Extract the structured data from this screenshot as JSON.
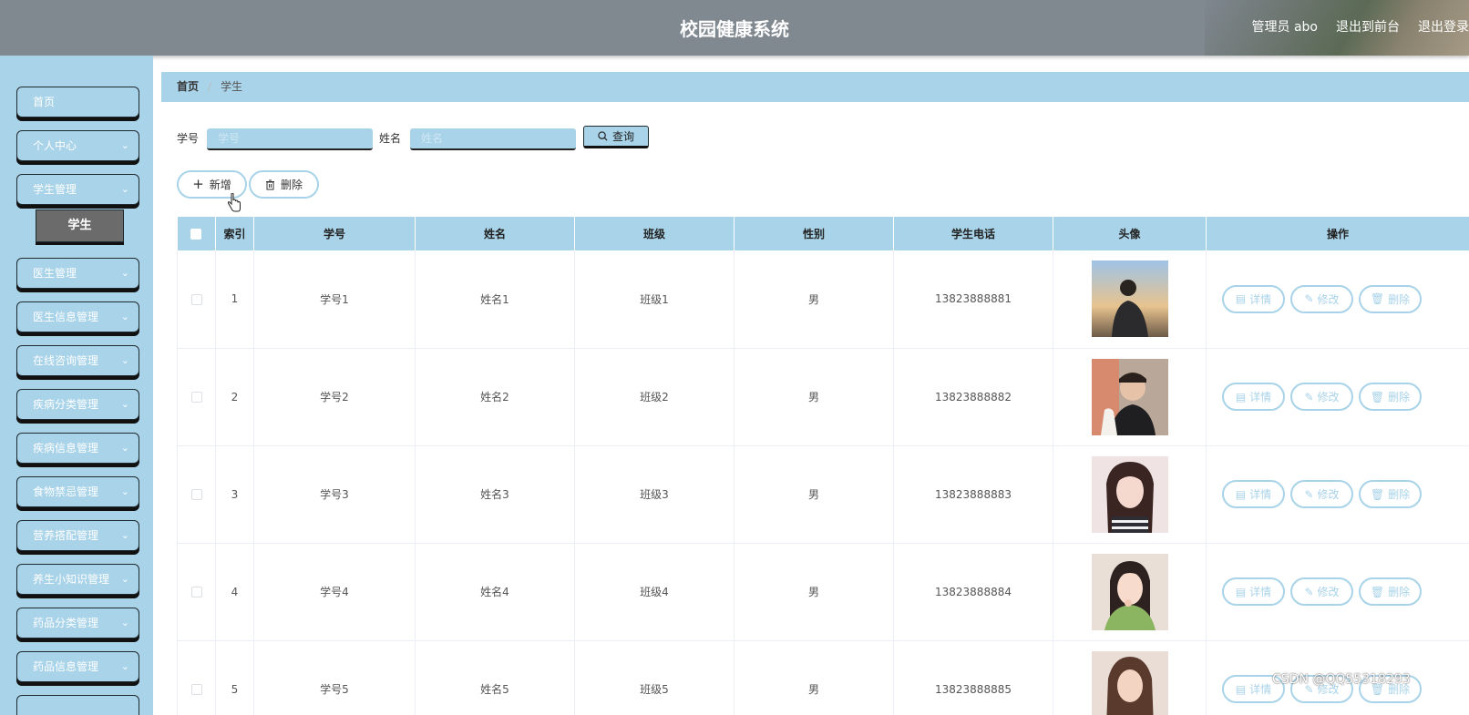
{
  "header": {
    "title": "校园健康系统",
    "admin": "管理员 abo",
    "exit_front": "退出到前台",
    "logout": "退出登录"
  },
  "sidebar": {
    "items": [
      {
        "label": "首页",
        "expandable": false
      },
      {
        "label": "个人中心",
        "expandable": true
      },
      {
        "label": "学生管理",
        "expandable": true
      },
      {
        "label": "医生管理",
        "expandable": true
      },
      {
        "label": "医生信息管理",
        "expandable": true
      },
      {
        "label": "在线咨询管理",
        "expandable": true
      },
      {
        "label": "疾病分类管理",
        "expandable": true
      },
      {
        "label": "疾病信息管理",
        "expandable": true
      },
      {
        "label": "食物禁忌管理",
        "expandable": true
      },
      {
        "label": "营养搭配管理",
        "expandable": true
      },
      {
        "label": "养生小知识管理",
        "expandable": true
      },
      {
        "label": "药品分类管理",
        "expandable": true
      },
      {
        "label": "药品信息管理",
        "expandable": true
      }
    ],
    "sub_item": "学生"
  },
  "breadcrumb": {
    "home": "首页",
    "current": "学生"
  },
  "search": {
    "student_no_label": "学号",
    "student_no_placeholder": "学号",
    "name_label": "姓名",
    "name_placeholder": "姓名",
    "button": "查询"
  },
  "actions": {
    "add": "新增",
    "delete": "删除"
  },
  "table": {
    "headers": [
      "索引",
      "学号",
      "姓名",
      "班级",
      "性别",
      "学生电话",
      "头像",
      "操作"
    ],
    "rows": [
      {
        "index": "1",
        "student_no": "学号1",
        "name": "姓名1",
        "class": "班级1",
        "gender": "男",
        "phone": "13823888881"
      },
      {
        "index": "2",
        "student_no": "学号2",
        "name": "姓名2",
        "class": "班级2",
        "gender": "男",
        "phone": "13823888882"
      },
      {
        "index": "3",
        "student_no": "学号3",
        "name": "姓名3",
        "class": "班级3",
        "gender": "男",
        "phone": "13823888883"
      },
      {
        "index": "4",
        "student_no": "学号4",
        "name": "姓名4",
        "class": "班级4",
        "gender": "男",
        "phone": "13823888884"
      },
      {
        "index": "5",
        "student_no": "学号5",
        "name": "姓名5",
        "class": "班级5",
        "gender": "男",
        "phone": "13823888885"
      }
    ],
    "row_actions": {
      "detail": "详情",
      "edit": "修改",
      "delete": "删除"
    }
  },
  "watermark": "CSDN @QQ55318293",
  "colors": {
    "accent": "#a8d3e8",
    "header": "#808890",
    "active_sub": "#6b6b6b"
  }
}
